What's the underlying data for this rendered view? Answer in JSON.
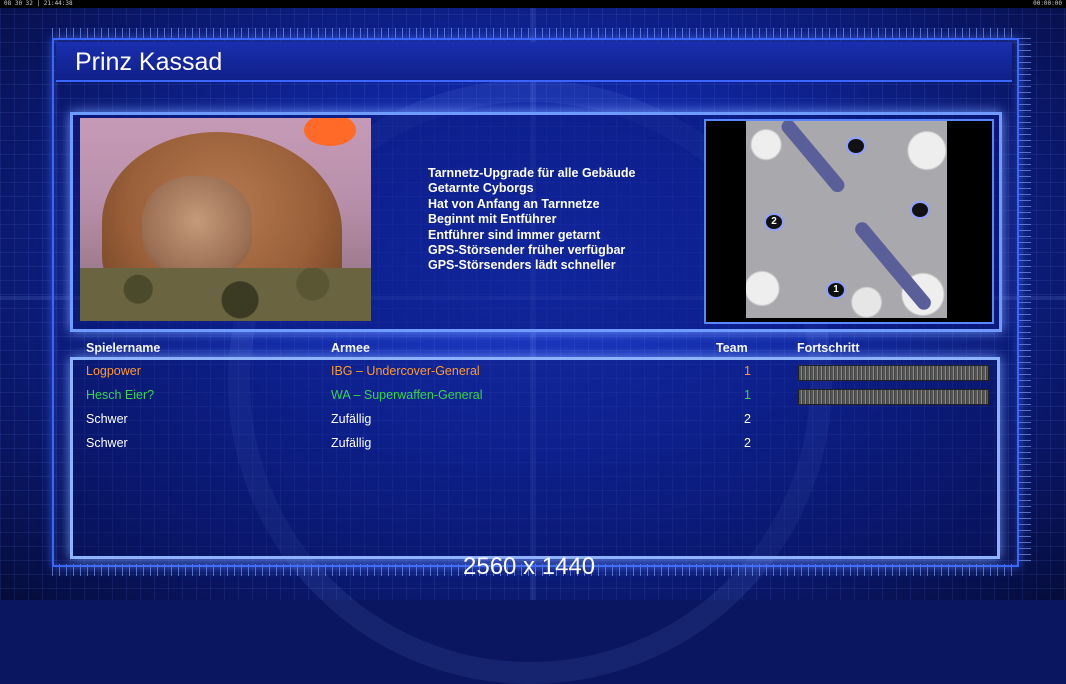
{
  "topbar": {
    "left_text": "08 30 32 | 21:44:38",
    "right_text": "00:00:00"
  },
  "general": {
    "name": "Prinz Kassad",
    "traits": [
      "Tarnnetz-Upgrade für alle Gebäude",
      "Getarnte Cyborgs",
      "Hat von Anfang an Tarnnetze",
      "Beginnt mit Entführer",
      "Entführer sind immer getarnt",
      "GPS-Störsender früher verfügbar",
      "GPS-Störsenders lädt schneller"
    ]
  },
  "map": {
    "start_markers": [
      "2",
      "1"
    ]
  },
  "table": {
    "headers": {
      "name": "Spielername",
      "army": "Armee",
      "team": "Team",
      "progress": "Fortschritt"
    },
    "rows": [
      {
        "name": "Logpower",
        "army": "IBG – Undercover-General",
        "team": "1",
        "color": "#ff9a2a",
        "has_progress": true
      },
      {
        "name": "Hesch Eier?",
        "army": "WA – Superwaffen-General",
        "team": "1",
        "color": "#36d64a",
        "has_progress": true
      },
      {
        "name": "Schwer",
        "army": "Zufällig",
        "team": "2",
        "color": "#ffffff",
        "has_progress": false
      },
      {
        "name": "Schwer",
        "army": "Zufällig",
        "team": "2",
        "color": "#ffffff",
        "has_progress": false
      }
    ]
  },
  "resolution_label": "2560 x 1440"
}
